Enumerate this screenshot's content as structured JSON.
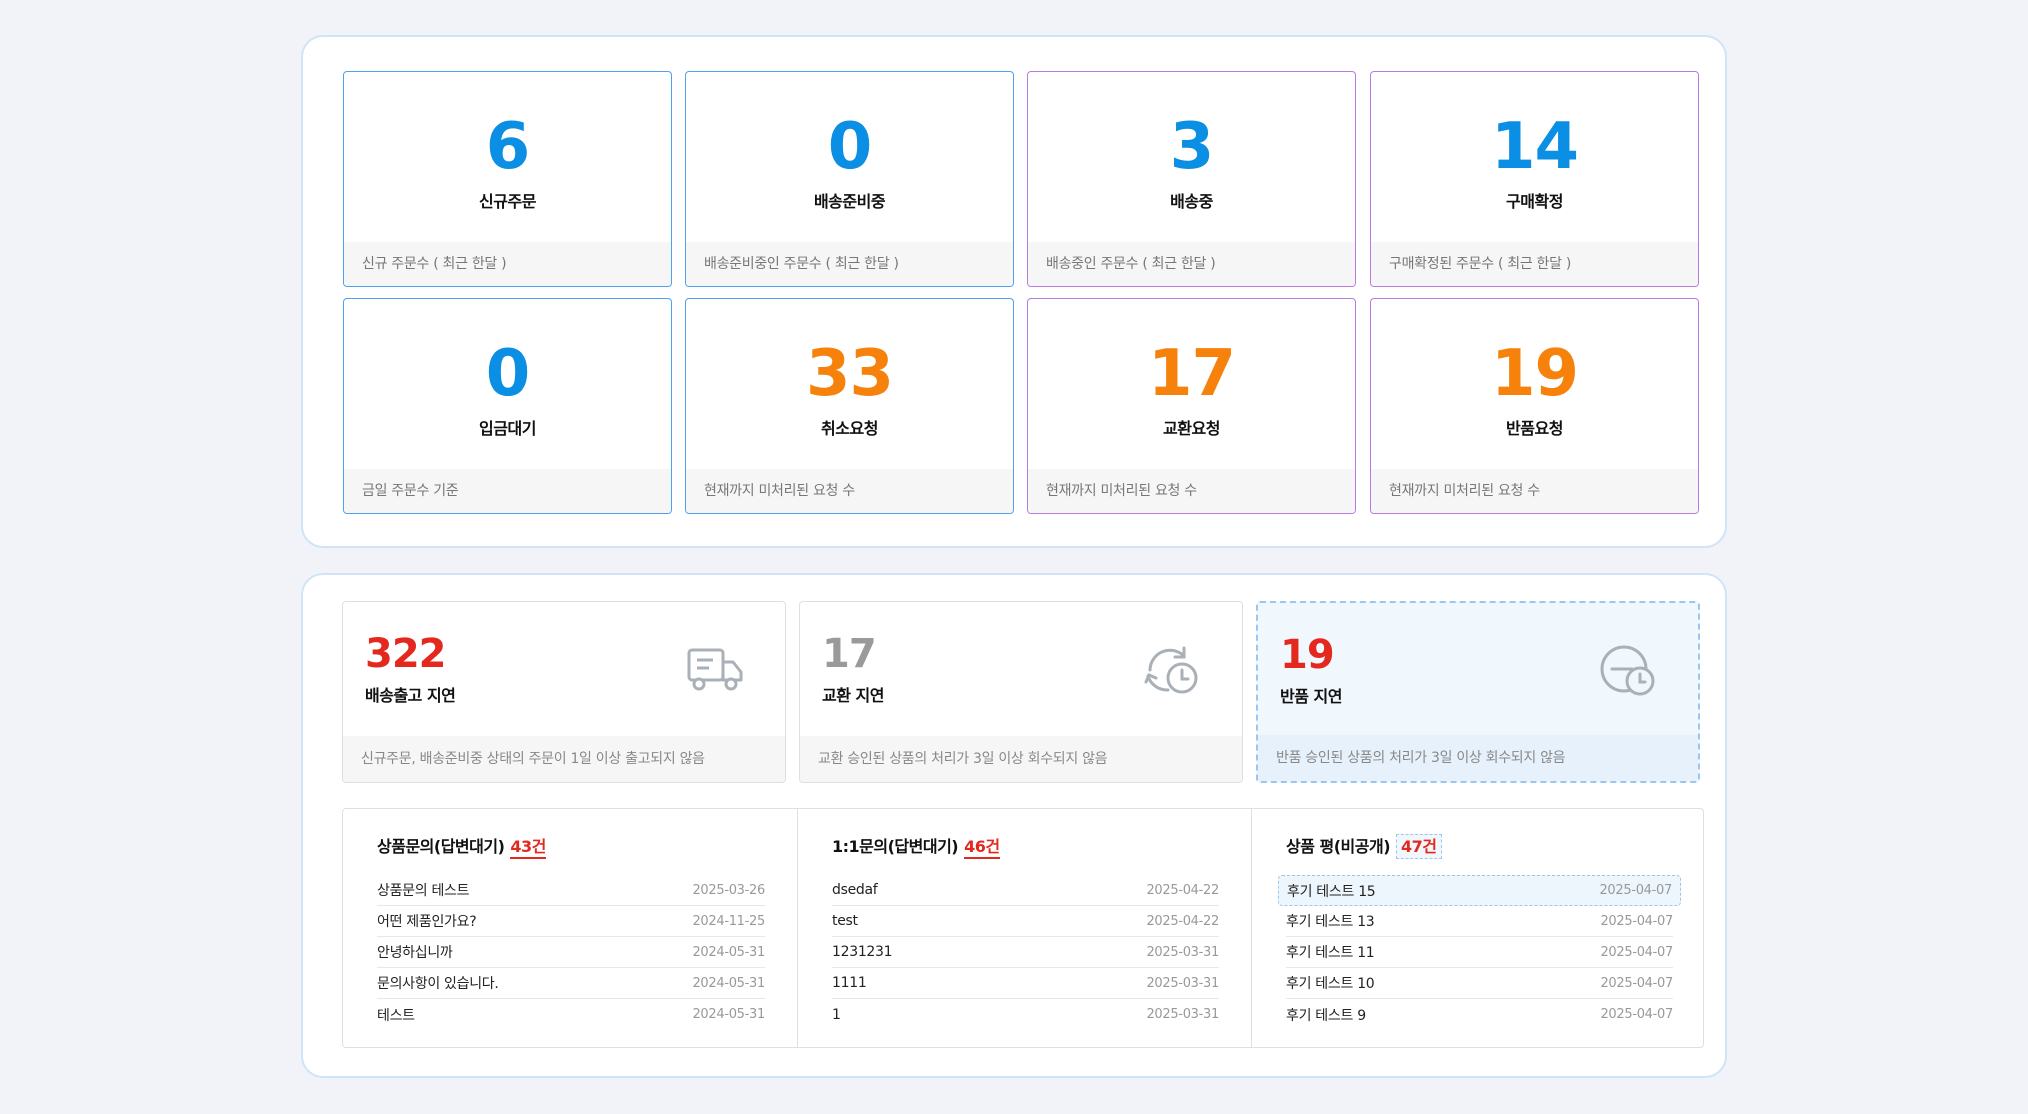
{
  "stats": [
    {
      "value": "6",
      "label": "신규주문",
      "foot": "신규 주문수 ( 최근 한달 )",
      "color": "#0a8fe4"
    },
    {
      "value": "0",
      "label": "배송준비중",
      "foot": "배송준비중인 주문수 ( 최근 한달 )",
      "color": "#0a8fe4"
    },
    {
      "value": "3",
      "label": "배송중",
      "foot": "배송중인 주문수 ( 최근 한달 )",
      "color": "#0a8fe4"
    },
    {
      "value": "14",
      "label": "구매확정",
      "foot": "구매확정된 주문수 ( 최근 한달 )",
      "color": "#0a8fe4"
    },
    {
      "value": "0",
      "label": "입금대기",
      "foot": "금일 주문수 기준",
      "color": "#0a8fe4"
    },
    {
      "value": "33",
      "label": "취소요청",
      "foot": "현재까지 미처리된 요청 수",
      "color": "#f6820c"
    },
    {
      "value": "17",
      "label": "교환요청",
      "foot": "현재까지 미처리된 요청 수",
      "color": "#f6820c"
    },
    {
      "value": "19",
      "label": "반품요청",
      "foot": "현재까지 미처리된 요청 수",
      "color": "#f6820c"
    }
  ],
  "delays": [
    {
      "value": "322",
      "label": "배송출고 지연",
      "foot": "신규주문, 배송준비중 상태의 주문이 1일 이상 출고되지 않음",
      "icon": "truck-icon",
      "color": "#e5281e"
    },
    {
      "value": "17",
      "label": "교환 지연",
      "foot": "교환 승인된 상품의 처리가 3일 이상 회수되지 않음",
      "icon": "exchange-clock-icon",
      "color": "#9a9a9a"
    },
    {
      "value": "19",
      "label": "반품 지연",
      "foot": "반품 승인된 상품의 처리가 3일 이상 회수되지 않음",
      "icon": "return-clock-icon",
      "color": "#e5281e"
    }
  ],
  "lists": [
    {
      "title": "상품문의(답변대기)",
      "count": "43건",
      "rows": [
        {
          "title": "상품문의 테스트",
          "date": "2025-03-26"
        },
        {
          "title": "어떤 제품인가요?",
          "date": "2024-11-25"
        },
        {
          "title": "안녕하십니까",
          "date": "2024-05-31"
        },
        {
          "title": "문의사항이 있습니다.",
          "date": "2024-05-31"
        },
        {
          "title": "테스트",
          "date": "2024-05-31"
        }
      ]
    },
    {
      "title": "1:1문의(답변대기)",
      "count": "46건",
      "rows": [
        {
          "title": "dsedaf",
          "date": "2025-04-22"
        },
        {
          "title": "test",
          "date": "2025-04-22"
        },
        {
          "title": "1231231",
          "date": "2025-03-31"
        },
        {
          "title": "1111",
          "date": "2025-03-31"
        },
        {
          "title": "1",
          "date": "2025-03-31"
        }
      ]
    },
    {
      "title": "상품 평(비공개)",
      "count": "47건",
      "rows": [
        {
          "title": "후기 테스트 15",
          "date": "2025-04-07"
        },
        {
          "title": "후기 테스트 13",
          "date": "2025-04-07"
        },
        {
          "title": "후기 테스트 11",
          "date": "2025-04-07"
        },
        {
          "title": "후기 테스트 10",
          "date": "2025-04-07"
        },
        {
          "title": "후기 테스트 9",
          "date": "2025-04-07"
        }
      ]
    }
  ]
}
